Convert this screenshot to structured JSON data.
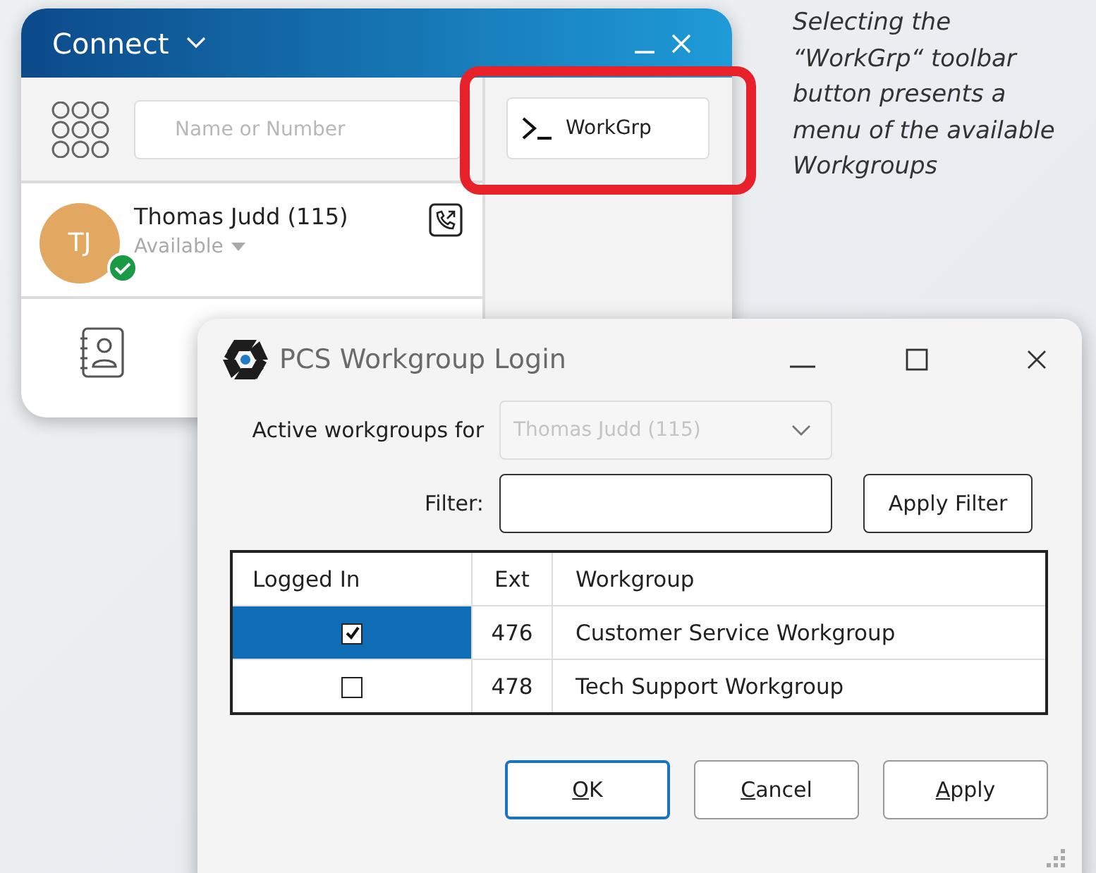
{
  "connect_window": {
    "title": "Connect",
    "search": {
      "placeholder": "Name or Number"
    },
    "contact": {
      "initials": "TJ",
      "name": "Thomas Judd (115)",
      "status": "Available",
      "available": true
    },
    "toolbar_button": {
      "label": "WorkGrp",
      "highlighted": true
    }
  },
  "annotation": "Selecting the “WorkGrp“ toolbar button presents a menu of the available Workgroups",
  "dialog": {
    "title": "PCS Workgroup Login",
    "user_field": {
      "label": "Active workgroups for",
      "value": "Thomas Judd (115)",
      "disabled": true
    },
    "filter_field": {
      "label": "Filter:"
    },
    "filter_button": "Apply Filter",
    "table": {
      "columns": [
        "Logged In",
        "Ext",
        "Workgroup"
      ],
      "rows": [
        {
          "logged_in": true,
          "selected": true,
          "ext": "476",
          "workgroup": "Customer Service Workgroup"
        },
        {
          "logged_in": false,
          "selected": false,
          "ext": "478",
          "workgroup": "Tech Support Workgroup"
        }
      ]
    },
    "buttons": [
      {
        "label": "OK",
        "default": true,
        "underline_first": true
      },
      {
        "label": "Cancel",
        "default": false,
        "underline_first": true
      },
      {
        "label": "Apply",
        "default": false,
        "underline_first": true
      }
    ]
  }
}
